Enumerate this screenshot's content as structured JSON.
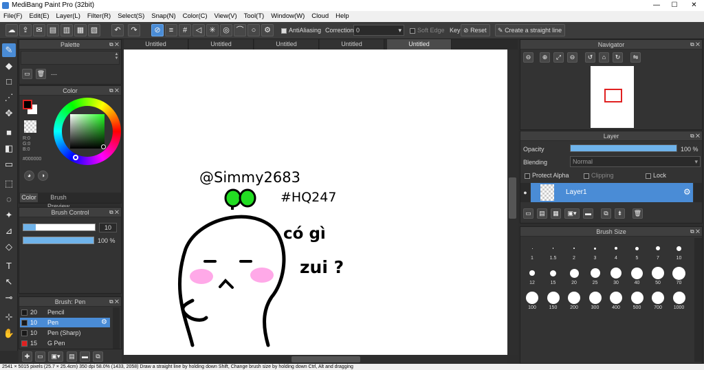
{
  "titlebar": {
    "title": "MediBang Paint Pro (32bit)",
    "minimize": "—",
    "maximize": "☐",
    "close": "✕"
  },
  "menu": [
    "File(F)",
    "Edit(E)",
    "Layer(L)",
    "Filter(R)",
    "Select(S)",
    "Snap(N)",
    "Color(C)",
    "View(V)",
    "Tool(T)",
    "Window(W)",
    "Cloud",
    "Help"
  ],
  "toolbar": {
    "antialiasing": "AntiAliasing",
    "correction_label": "Correction",
    "correction_value": "0",
    "soft_edge": "Soft Edge",
    "key": "Key",
    "reset": "Reset",
    "straight_line": "Create a straight line"
  },
  "tabs": [
    "Untitled",
    "Untitled",
    "Untitled",
    "Untitled",
    "Untitled"
  ],
  "palette": {
    "title": "Palette",
    "entry": "---"
  },
  "color": {
    "title": "Color",
    "r": "R:0",
    "g": "G:0",
    "b": "B:0",
    "hex": "#000000",
    "tab_color": "Color",
    "tab_preview": "Brush Preview"
  },
  "brush_control": {
    "title": "Brush Control",
    "size": "10",
    "opacity": "100 %",
    "size_fraction": 0.1,
    "opacity_fraction": 1.0
  },
  "brush_list": {
    "title": "Brush: Pen",
    "items": [
      {
        "size": "20",
        "name": "Pencil",
        "color": "#1a1a1a",
        "selected": false
      },
      {
        "size": "10",
        "name": "Pen",
        "color": "#1a1a1a",
        "selected": true
      },
      {
        "size": "10",
        "name": "Pen (Sharp)",
        "color": "#1a1a1a",
        "selected": false
      },
      {
        "size": "15",
        "name": "G Pen",
        "color": "#e02020",
        "selected": false
      }
    ]
  },
  "navigator": {
    "title": "Navigator"
  },
  "layer": {
    "title": "Layer",
    "opacity_label": "Opacity",
    "opacity_value": "100 %",
    "opacity_fraction": 1.0,
    "blending_label": "Blending",
    "blending_value": "Normal",
    "protect_alpha": "Protect Alpha",
    "clipping": "Clipping",
    "lock": "Lock",
    "layer_name": "Layer1"
  },
  "brush_size": {
    "title": "Brush Size",
    "sizes": [
      "1",
      "1.5",
      "2",
      "3",
      "4",
      "5",
      "7",
      "10",
      "12",
      "15",
      "20",
      "25",
      "30",
      "40",
      "50",
      "70",
      "100",
      "150",
      "200",
      "300",
      "400",
      "500",
      "700",
      "1000"
    ]
  },
  "canvas_text": {
    "handle": "@Simmy2683",
    "tag": "#HQ247",
    "line1": "có gì",
    "line2": "zui ?"
  },
  "status": "2541 × 5015 pixels (25.7 × 25.4cm)   350 dpi   58.0%   (1433, 2058)   Draw a straight line by holding down Shift, Change brush size by holding down Ctrl, Alt and dragging",
  "colors": {
    "accent": "#4a8cd6",
    "panel": "#333333",
    "canvas": "#ffffff",
    "cheek": "#ff8ce0",
    "sprout": "#22dd22"
  }
}
